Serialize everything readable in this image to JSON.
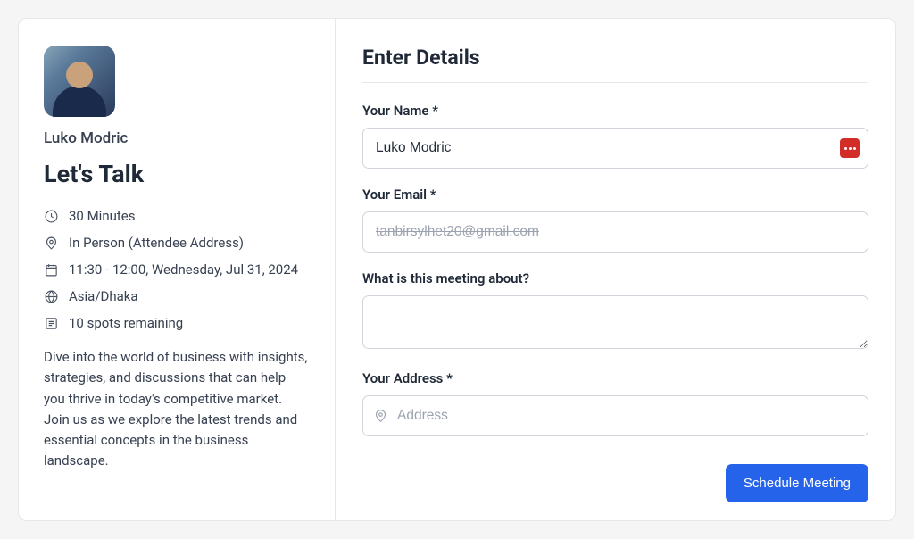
{
  "sidebar": {
    "host_name": "Luko Modric",
    "event_title": "Let's Talk",
    "meta": {
      "duration": "30 Minutes",
      "location": "In Person (Attendee Address)",
      "datetime": "11:30 - 12:00, Wednesday, Jul 31, 2024",
      "timezone": "Asia/Dhaka",
      "spots": "10 spots remaining"
    },
    "description": "Dive into the world of business with insights, strategies, and discussions that can help you thrive in today's competitive market. Join us as we explore the latest trends and essential concepts in the business landscape."
  },
  "form": {
    "title": "Enter Details",
    "name_label": "Your Name *",
    "name_value": "Luko Modric",
    "email_label": "Your Email *",
    "email_value": "tanbirsylhet20@gmail.com",
    "about_label": "What is this meeting about?",
    "about_value": "",
    "address_label": "Your Address *",
    "address_placeholder": "Address",
    "submit_label": "Schedule Meeting"
  }
}
